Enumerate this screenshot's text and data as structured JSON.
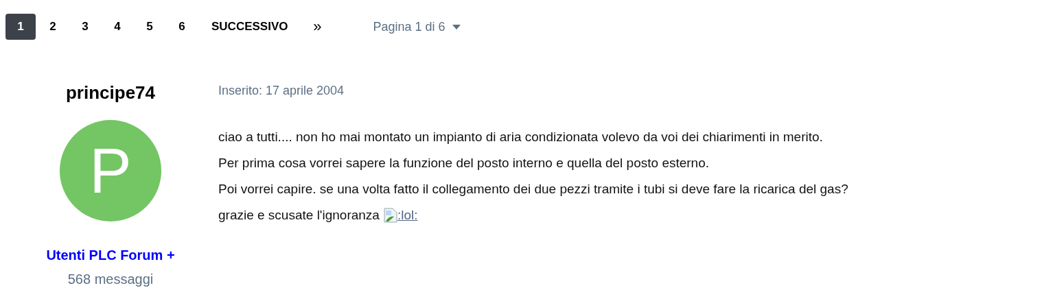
{
  "pagination": {
    "pages": [
      {
        "label": "1",
        "selected": true
      },
      {
        "label": "2",
        "selected": false
      },
      {
        "label": "3",
        "selected": false
      },
      {
        "label": "4",
        "selected": false
      },
      {
        "label": "5",
        "selected": false
      },
      {
        "label": "6",
        "selected": false
      }
    ],
    "next": "SUCCESSIVO",
    "last": "»",
    "page_jump": "Pagina 1 di 6"
  },
  "post": {
    "author": {
      "name": "principe74",
      "avatar_letter": "P",
      "color": "#73c663",
      "group": "Utenti PLC Forum +",
      "post_count": "568 messaggi"
    },
    "posted": "Inserito: 17 aprile 2004",
    "lines": [
      "ciao a tutti.... non ho mai montato un impianto di aria condizionata volevo da voi dei chiarimenti in merito.",
      "Per prima cosa vorrei sapere la funzione del posto interno e quella del posto esterno.",
      "Poi vorrei capire. se una volta fatto il collegamento dei due pezzi tramite i tubi si deve fare la ricarica del gas?",
      "grazie e scusate l'ignoranza"
    ],
    "emoticon_alt": ":lol:"
  }
}
